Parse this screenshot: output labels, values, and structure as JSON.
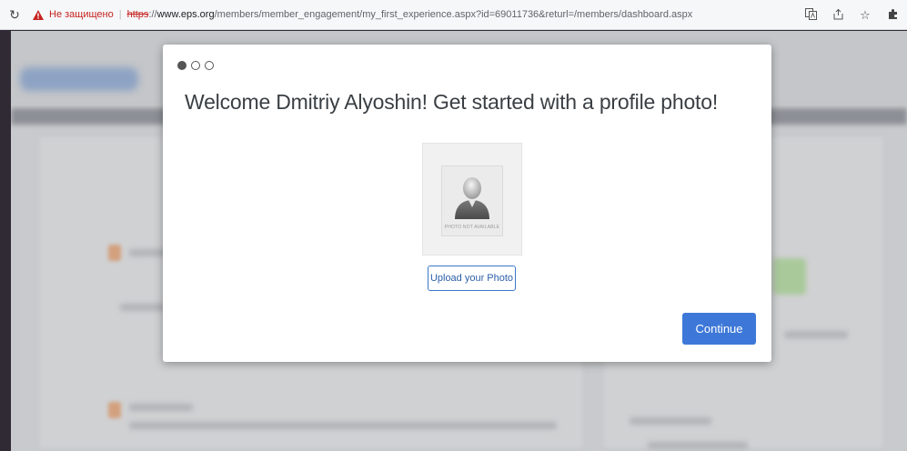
{
  "browser": {
    "reload_icon": "reload-icon",
    "security_warning": "Не защищено",
    "url_scheme": "https",
    "url_host": "www.eps.org",
    "url_path": "/members/member_engagement/my_first_experience.aspx?id=69011736&returl=/members/dashboard.aspx",
    "toolbar_icons": [
      "translate-icon",
      "share-icon",
      "bookmark-star-icon",
      "extensions-icon"
    ]
  },
  "modal": {
    "steps": {
      "total": 3,
      "current": 1
    },
    "title": "Welcome Dmitriy Alyoshin! Get started with a profile photo!",
    "photo_placeholder_text": "PHOTO NOT AVAILABLE",
    "upload_label": "Upload your Photo",
    "continue_label": "Continue"
  },
  "colors": {
    "primary_button": "#3d78d8",
    "upload_border": "#3c78c8",
    "insecure_red": "#c5221f",
    "overlay_bg": "#c9cacd"
  }
}
